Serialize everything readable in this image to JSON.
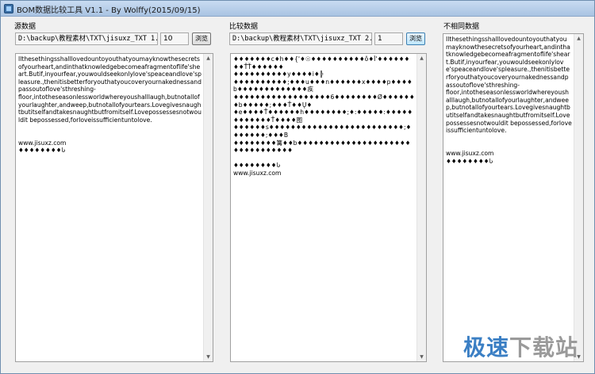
{
  "window": {
    "title": "BOM数据比较工具 V1.1 - By Wolffy(2015/09/15)"
  },
  "source": {
    "label": "源数据",
    "path": "D:\\backup\\教程素材\\TXT\\jisuxz_TXT 1.",
    "count": "10",
    "browse_label": "浏览",
    "text": "Ilthesethingsshalllovedountoyouthatyoumayknowthesecretsofyourheart,andinthatknowledgebecomeafragmentoflife'sheart.Butif,inyourfear,youwouldseekonlylove'speaceandlove'spleasure.,thenitisbetterforyouthatyoucoveryournakednessandpassoutoflove'sthreshing-\nfloor,intotheseasonlessworldwhereyoushalllaugh,butnotallofyourlaughter,andweep,butnotallofyourtears.Lovegivesnaughtbutitselfandtakesnaughtbutfromitself.Lovepossessesnotwouldit bepossessed,forloveissufficientuntolove.\n\n\nwww.jisuxz.com\n♦♦♦♦♦♦♦♦Ⴑ"
  },
  "compare": {
    "label": "比较数据",
    "path": "D:\\backup\\教程素材\\TXT\\jisuxz_TXT 2.",
    "count": "1",
    "browse_label": "浏览",
    "text": "♦♦♦♦♦♦♦c♦h♦♦{'♦☉♦♦♦♦♦♦♦♦♦♦ǒ♦Ĭ'♦♦♦♦♦♦♦♦ŤŤ♦♦♦♦♦♦\n♦♦♦♦♦♦♦♦♦♦y♦♦♦♦i♦╠\n♦♦♦♦♦♦♦♦♦♦;♦♦♦u♦♦♦n♦♦♦♦♦♦x♦♦♦♦p♦♦♦♦b♦♦♦♦♦♦♦♦♦♦♦♦♦疾\n♦♦♦♦♦♦♦♦♦♦♦♦♦♦♦♦♦♦6♦♦♦♦♦♦♦♦Ø♦♦♦♦♦♦♦b♦♦♦♦♦;♦♦♦Ť♦♦Ų♦\n♦e♦♦♦♦Ť♦♦♦♦♦♦h♦♦♦♦♦♦♦♦;♦:♦♦♦♦♦:♦♦♦♦♦♦♦♦♦♦♦♦Ť♦♦♦♦图\n♦♦♦♦♦♦s♦♦♦♦♦♦♦♦♦♦♦♦♦♦♦♦♦♦♦♦♦♦♦♦♦;♦♦♦♦♦♦♦;♦♦♦B\n♦♦♦♦♦♦♦♦篝♦♦b♦♦♦♦♦♦♦♦♦♦♦♦♦♦♦♦♦♦♦♦♦♦♦♦♦♦♦♦♦♦♦♦\n\n♦♦♦♦♦♦♦♦Ⴑ\nwww.jisuxz.com"
  },
  "diff": {
    "label": "不相同数据",
    "text": "Ilthesethingsshalllovedountoyouthatyoumayknowthesecretsofyourheart,andinthatknowledgebecomeafragmentoflife'sheart.Butif,inyourfear,youwouldseekonlylove'speaceandlove'spleasure.,thenitisbetterforyouthatyoucoveryournakednessandpassoutoflove'sthreshing-\nfloor,intotheseasonlessworldwhereyoushalllaugh,butnotallofyourlaughter,andweep,butnotallofyourtears.Lovegivesnaughtbutitselfandtakesnaughtbutfromitself.Lovepossessesnotwouldit bepossessed,forloveissufficientuntolove.\n\n\nwww.jisuxz.com\n♦♦♦♦♦♦♦♦Ⴑ"
  },
  "watermark": {
    "part1": "极速",
    "part2": "下载站"
  },
  "icons": {
    "scroll_up": "▲",
    "scroll_down": "▼"
  }
}
